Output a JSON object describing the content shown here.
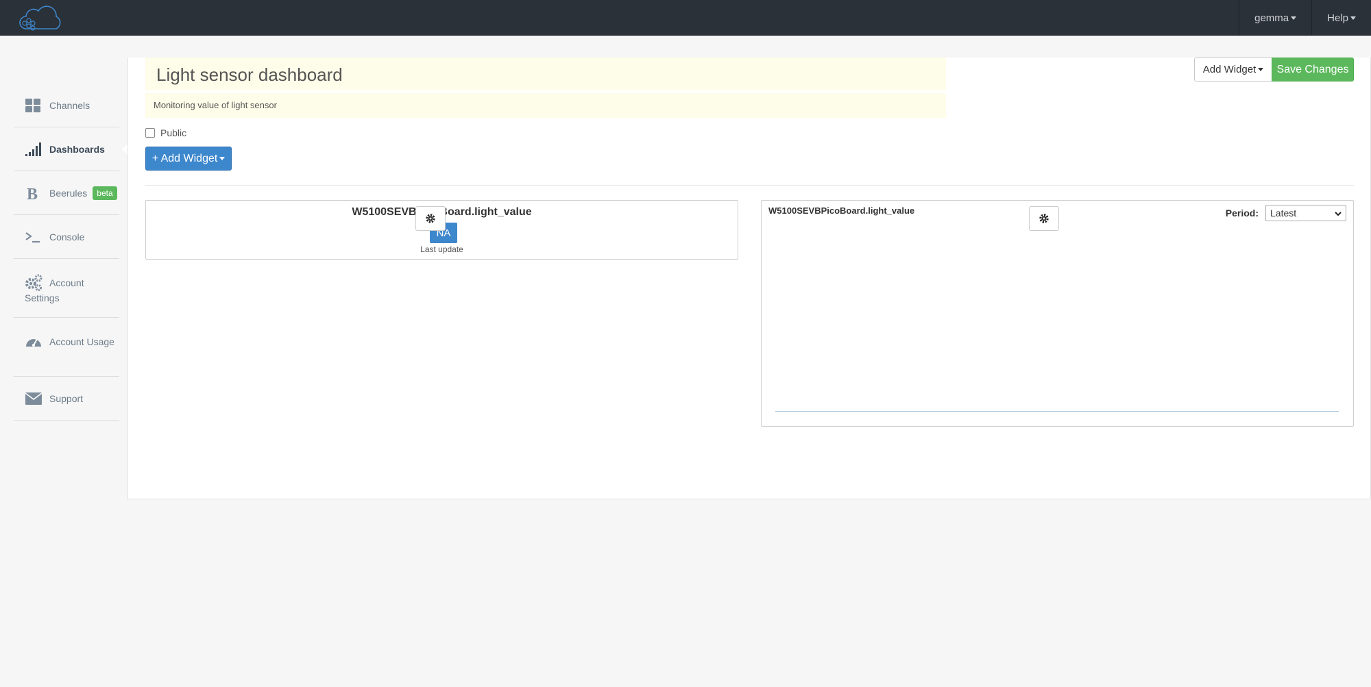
{
  "navbar": {
    "user_label": "gemma",
    "help_label": "Help"
  },
  "sidebar": {
    "items": [
      {
        "label": "Channels",
        "icon": "grid-icon"
      },
      {
        "label": "Dashboards",
        "icon": "signal-bars-icon",
        "active": true
      },
      {
        "label": "Beerules",
        "icon": "bold-b-icon",
        "badge": "beta"
      },
      {
        "label": "Console",
        "icon": "terminal-prompt-icon"
      },
      {
        "label": "Account Settings",
        "icon": "gears-icon"
      },
      {
        "label": "Account Usage",
        "icon": "speedometer-icon"
      },
      {
        "label": "Support",
        "icon": "envelope-icon"
      }
    ]
  },
  "dashboard": {
    "title": "Light sensor dashboard",
    "description": "Monitoring value of light sensor",
    "public_label": "Public",
    "public_checked": false,
    "add_widget_blue": "+ Add Widget",
    "add_widget_top": "Add Widget",
    "save_changes": "Save Changes"
  },
  "widgets": {
    "value_widget": {
      "title": "W5100SEVBPicoBoard.light_value",
      "value": "NA",
      "subtitle": "Last update"
    },
    "chart_widget": {
      "title": "W5100SEVBPicoBoard.light_value",
      "period_label": "Period:",
      "period_value": "Latest"
    }
  },
  "colors": {
    "navbar": "#2b3138",
    "primary": "#3d87cd",
    "success": "#5cb85c",
    "note_bg": "#fefde9"
  }
}
